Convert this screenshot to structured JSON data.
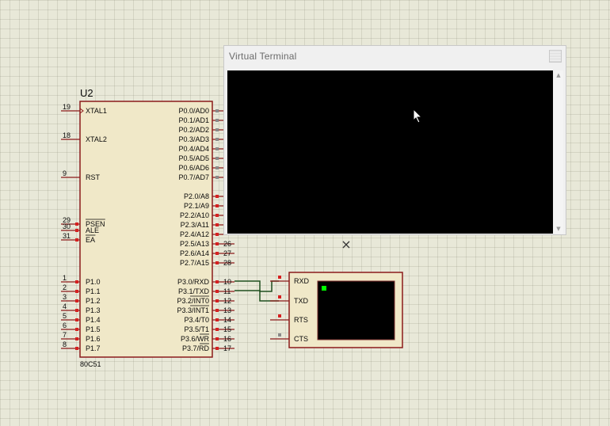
{
  "mcu": {
    "ref": "U2",
    "part": "80C51",
    "left_pins": [
      {
        "num": "19",
        "name": "XTAL1"
      },
      {
        "num": "18",
        "name": "XTAL2"
      },
      {
        "num": "9",
        "name": "RST"
      },
      {
        "num": "29",
        "name": "PSEN"
      },
      {
        "num": "30",
        "name": "ALE"
      },
      {
        "num": "31",
        "name": "EA"
      },
      {
        "num": "1",
        "name": "P1.0"
      },
      {
        "num": "2",
        "name": "P1.1"
      },
      {
        "num": "3",
        "name": "P1.2"
      },
      {
        "num": "4",
        "name": "P1.3"
      },
      {
        "num": "5",
        "name": "P1.4"
      },
      {
        "num": "6",
        "name": "P1.5"
      },
      {
        "num": "7",
        "name": "P1.6"
      },
      {
        "num": "8",
        "name": "P1.7"
      }
    ],
    "right_pins": [
      {
        "num": "",
        "name": "P0.0/AD0"
      },
      {
        "num": "",
        "name": "P0.1/AD1"
      },
      {
        "num": "",
        "name": "P0.2/AD2"
      },
      {
        "num": "",
        "name": "P0.3/AD3"
      },
      {
        "num": "",
        "name": "P0.4/AD4"
      },
      {
        "num": "",
        "name": "P0.5/AD5"
      },
      {
        "num": "",
        "name": "P0.6/AD6"
      },
      {
        "num": "",
        "name": "P0.7/AD7"
      },
      {
        "num": "",
        "name": "P2.0/A8"
      },
      {
        "num": "",
        "name": "P2.1/A9"
      },
      {
        "num": "",
        "name": "P2.2/A10"
      },
      {
        "num": "",
        "name": "P2.3/A11"
      },
      {
        "num": "",
        "name": "P2.4/A12"
      },
      {
        "num": "26",
        "name": "P2.5/A13"
      },
      {
        "num": "27",
        "name": "P2.6/A14"
      },
      {
        "num": "28",
        "name": "P2.7/A15"
      },
      {
        "num": "10",
        "name": "P3.0/RXD"
      },
      {
        "num": "11",
        "name": "P3.1/TXD"
      },
      {
        "num": "12",
        "name": "P3.2/INT0"
      },
      {
        "num": "13",
        "name": "P3.3/INT1"
      },
      {
        "num": "14",
        "name": "P3.4/T0"
      },
      {
        "num": "15",
        "name": "P3.5/T1"
      },
      {
        "num": "16",
        "name": "P3.6/WR"
      },
      {
        "num": "17",
        "name": "P3.7/RD"
      }
    ]
  },
  "terminal_component": {
    "pins": [
      "RXD",
      "TXD",
      "RTS",
      "CTS"
    ],
    "led_color": "#00ff00"
  },
  "virtual_terminal": {
    "title": "Virtual Terminal"
  },
  "colors": {
    "component_outline": "#8b1a1a",
    "component_fill": "#f0e8c8",
    "wire": "#1f4f1f",
    "pin_marker": "#d62020",
    "pin_marker_unconnected": "#8a8a8a"
  },
  "close_mark": "×"
}
